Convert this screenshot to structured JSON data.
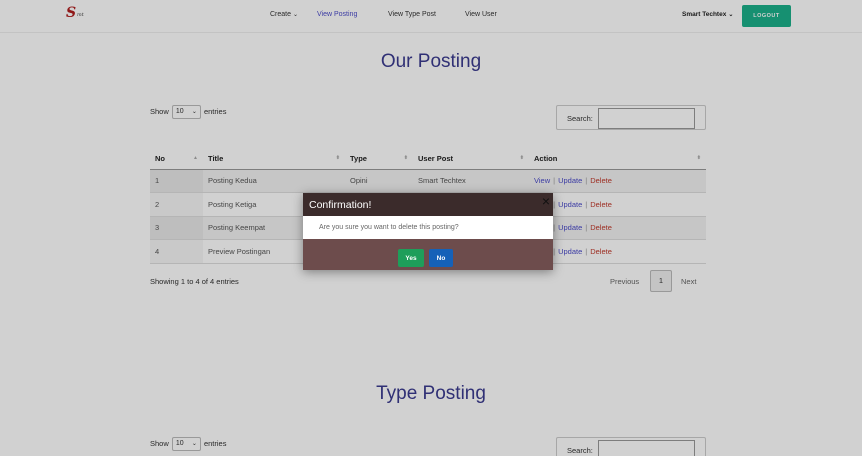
{
  "navbar": {
    "logo_text": "S",
    "logo_small": "mt",
    "items": [
      {
        "label": "Create",
        "has_dropdown": true
      },
      {
        "label": "View Posting",
        "active": true
      },
      {
        "label": "View Type Post"
      },
      {
        "label": "View User"
      }
    ],
    "user_name": "Smart Techtex",
    "logout_label": "LOGOUT"
  },
  "posting_section": {
    "title": "Our Posting",
    "length_prefix": "Show",
    "length_value": "10",
    "length_suffix": "entries",
    "search_label": "Search:",
    "search_value": "",
    "columns": [
      "No",
      "Title",
      "Type",
      "User Post",
      "Action"
    ],
    "rows": [
      {
        "no": "1",
        "title": "Posting Kedua",
        "type": "Opini",
        "user": "Smart Techtex"
      },
      {
        "no": "2",
        "title": "Posting Ketiga",
        "type": "",
        "user": ""
      },
      {
        "no": "3",
        "title": "Posting Keempat",
        "type": "",
        "user": ""
      },
      {
        "no": "4",
        "title": "Preview Postingan",
        "type": "",
        "user": ""
      }
    ],
    "actions": {
      "view": "View",
      "update": "Update",
      "delete": "Delete",
      "separator": "|"
    },
    "info": "Showing 1 to 4 of 4 entries",
    "pager": {
      "previous": "Previous",
      "current": "1",
      "next": "Next"
    }
  },
  "type_section": {
    "title": "Type Posting",
    "length_prefix": "Show",
    "length_value": "10",
    "length_suffix": "entries",
    "search_label": "Search:"
  },
  "modal": {
    "title": "Confirmation!",
    "close_glyph": "×",
    "message": "Are you sure you want to delete this posting?",
    "yes_label": "Yes",
    "no_label": "No"
  },
  "colors": {
    "accent": "#3b3b8f",
    "logout": "#1bb08a",
    "yes": "#1e9e5a",
    "no": "#1561b8",
    "delete": "#c0392b"
  }
}
